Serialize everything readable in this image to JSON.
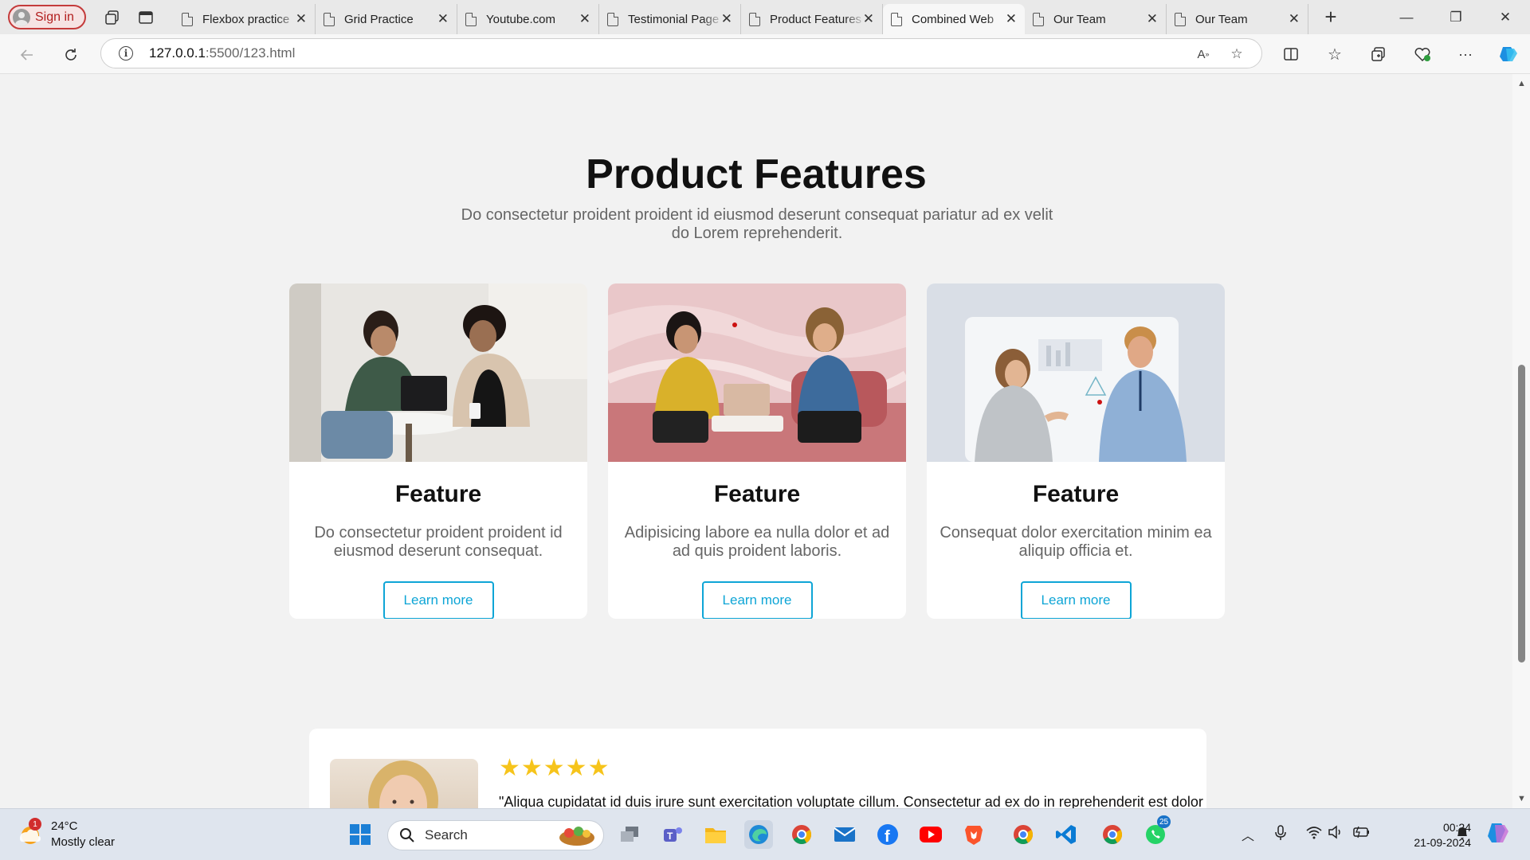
{
  "browser": {
    "signin_label": "Sign in",
    "tabs": [
      {
        "title": "Flexbox practice",
        "active": false
      },
      {
        "title": "Grid Practice",
        "active": false
      },
      {
        "title": "Youtube.com",
        "active": false
      },
      {
        "title": "Testimonial Page",
        "active": false
      },
      {
        "title": "Product Features",
        "active": false
      },
      {
        "title": "Combined Web",
        "active": true
      },
      {
        "title": "Our Team",
        "active": false
      },
      {
        "title": "Our Team",
        "active": false
      }
    ],
    "url_host": "127.0.0.1",
    "url_path": ":5500/123.html"
  },
  "page": {
    "title": "Product Features",
    "subtitle": "Do consectetur proident proident id eiusmod deserunt consequat pariatur ad ex velit do Lorem reprehenderit.",
    "cards": [
      {
        "heading": "Feature",
        "text": "Do consectetur proident proident id eiusmod deserunt consequat.",
        "button": "Learn more"
      },
      {
        "heading": "Feature",
        "text": "Adipisicing labore ea nulla dolor et ad ad quis proident laboris.",
        "button": "Learn more"
      },
      {
        "heading": "Feature",
        "text": "Consequat dolor exercitation minim ea aliquip officia et.",
        "button": "Learn more"
      }
    ],
    "testimonial": {
      "stars": "★★★★★",
      "rating": 5,
      "quote": "\"Aliqua cupidatat id duis irure sunt exercitation voluptate cillum. Consectetur ad ex do in reprehenderit est dolor"
    }
  },
  "taskbar": {
    "weather_temp": "24°C",
    "weather_desc": "Mostly clear",
    "weather_badge": "1",
    "search_placeholder": "Search",
    "chat_badge": "25",
    "time": "00:24",
    "date": "21-09-2024"
  },
  "colors": {
    "accent": "#0ea5d6",
    "star": "#f6c41b",
    "page_bg": "#f2f2f2"
  }
}
